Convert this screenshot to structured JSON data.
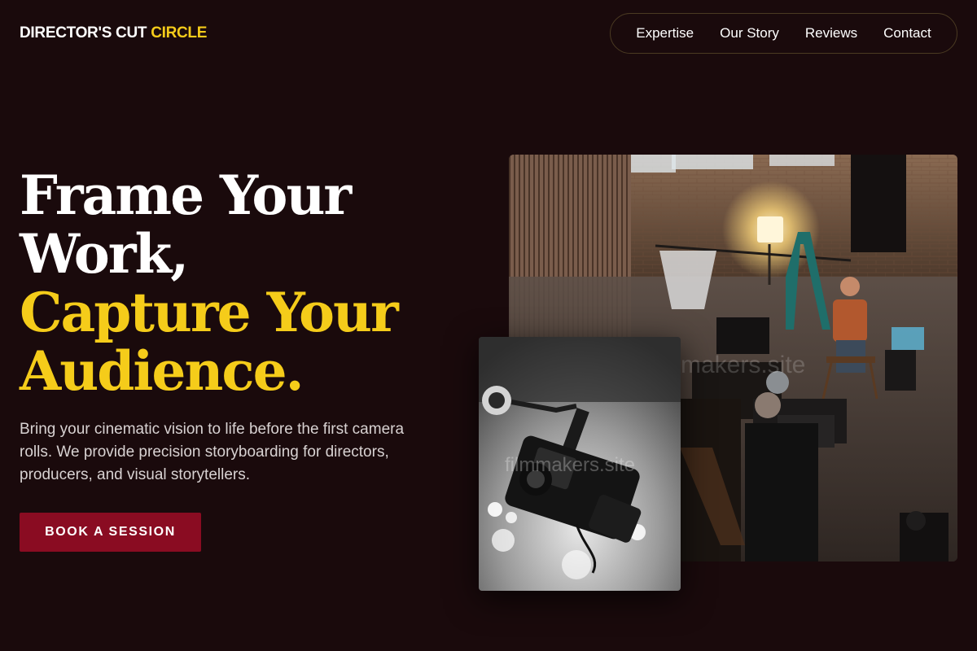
{
  "header": {
    "brand_main": "DIRECTOR'S CUT",
    "brand_accent": "CIRCLE"
  },
  "nav": {
    "items": [
      "Expertise",
      "Our Story",
      "Reviews",
      "Contact"
    ]
  },
  "hero": {
    "headline_line1": "Frame Your",
    "headline_line2": "Work,",
    "headline_line3": "Capture Your",
    "headline_line4": "Audience.",
    "description": "Bring your cinematic vision to life before the first camera rolls. We provide precision storyboarding for directors, producers, and visual storytellers.",
    "cta_label": "BOOK A SESSION"
  },
  "images": {
    "watermark_small": "filmmakers.site",
    "watermark_main": "makers.site"
  },
  "colors": {
    "background": "#1a0a0c",
    "accent_gold": "#f5cc1a",
    "cta_red": "#8a0c22"
  }
}
